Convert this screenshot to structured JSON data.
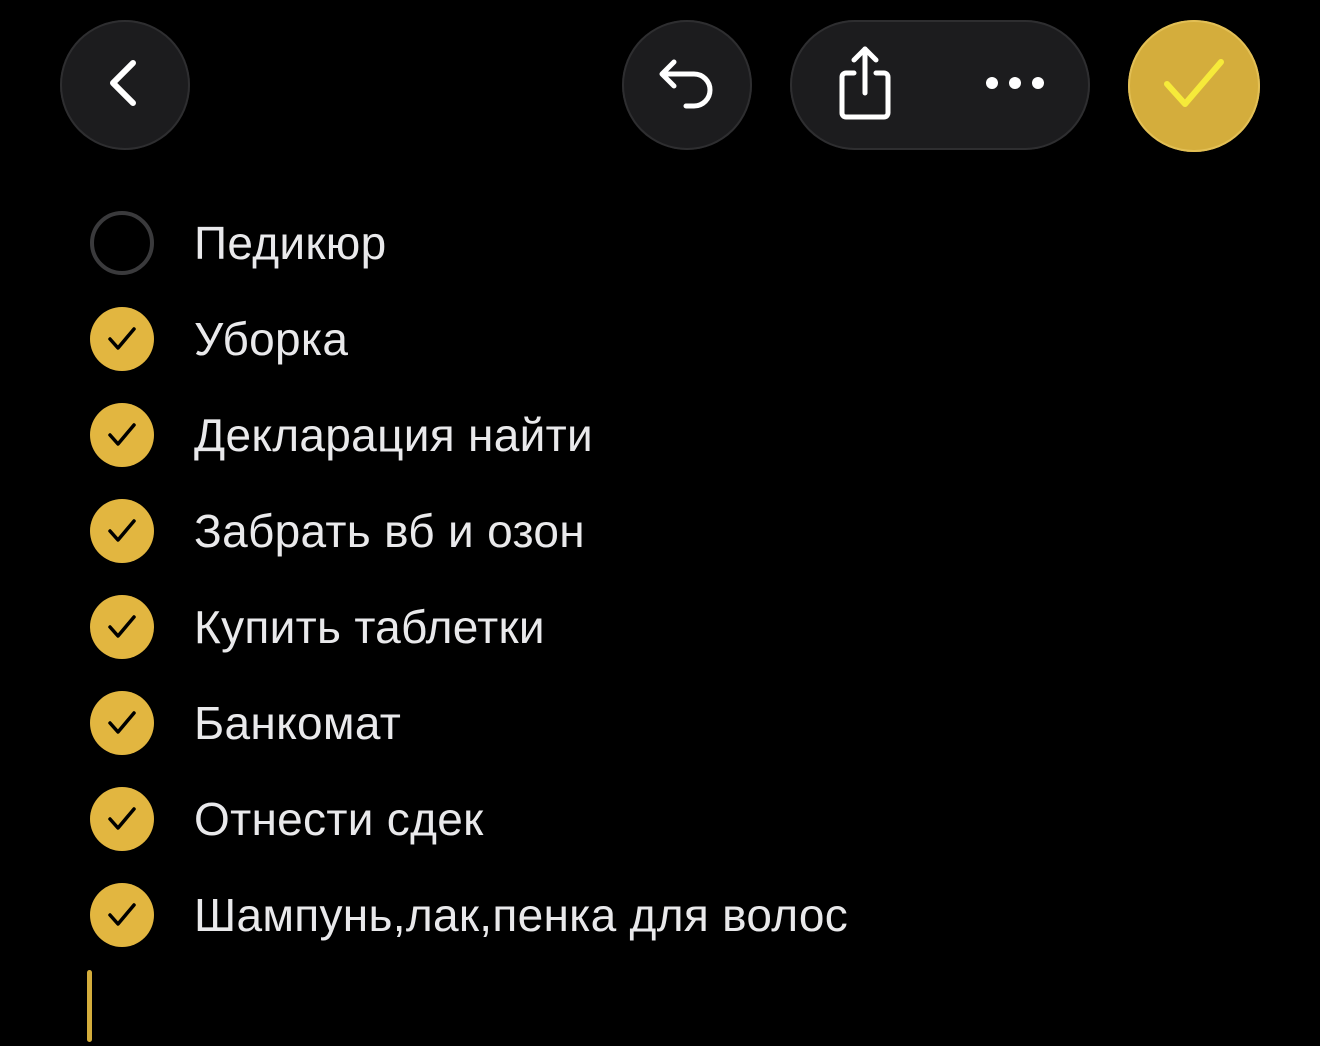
{
  "toolbar": {
    "back": {
      "icon": "chevron-left-icon"
    },
    "undo": {
      "icon": "undo-icon"
    },
    "share": {
      "icon": "share-icon"
    },
    "more": {
      "icon": "ellipsis-icon"
    },
    "done": {
      "icon": "checkmark-icon",
      "color": "#d4ad3c"
    }
  },
  "checklist": {
    "items": [
      {
        "label": "Педикюр",
        "checked": false
      },
      {
        "label": "Уборка",
        "checked": true
      },
      {
        "label": "Декларация найти",
        "checked": true
      },
      {
        "label": "Забрать вб и озон",
        "checked": true
      },
      {
        "label": "Купить таблетки",
        "checked": true
      },
      {
        "label": "Банкомат",
        "checked": true
      },
      {
        "label": "Отнести сдек",
        "checked": true
      },
      {
        "label": "Шампунь,лак,пенка для волос",
        "checked": true
      }
    ]
  },
  "colors": {
    "background": "#000000",
    "accent": "#e2b640",
    "text": "#e9e9eb",
    "button_bg": "#1c1c1e"
  }
}
